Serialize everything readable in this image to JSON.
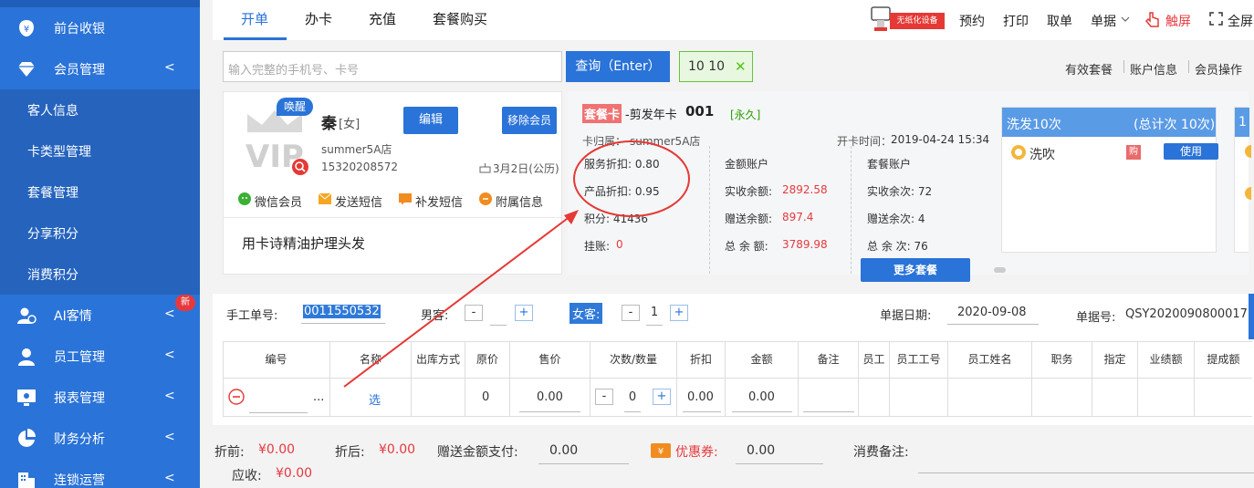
{
  "sidebar": {
    "items": [
      {
        "label": "前台收银",
        "icon": "yen-icon"
      },
      {
        "label": "会员管理",
        "icon": "diamond-icon"
      },
      {
        "label": "AI客情",
        "icon": "ai-user-icon",
        "badge": "新"
      },
      {
        "label": "员工管理",
        "icon": "person-icon"
      },
      {
        "label": "报表管理",
        "icon": "monitor-icon"
      },
      {
        "label": "财务分析",
        "icon": "pie-icon"
      },
      {
        "label": "连锁运营",
        "icon": "building-icon"
      }
    ],
    "sub_items": [
      "客人信息",
      "卡类型管理",
      "套餐管理",
      "分享积分",
      "消费积分"
    ],
    "chevron": "<"
  },
  "tabs": [
    "开单",
    "办卡",
    "充值",
    "套餐购买"
  ],
  "top_actions": {
    "device": "无纸化设备",
    "items": [
      "预约",
      "打印",
      "取单",
      "单据",
      "触屏",
      "全屏"
    ]
  },
  "search": {
    "placeholder": "输入完整的手机号、卡号",
    "button": "查询（Enter）",
    "tag": "10 10",
    "tag_close": "✕"
  },
  "links": [
    "有效套餐",
    "账户信息",
    "会员操作"
  ],
  "member": {
    "wake": "唤醒",
    "name": "秦",
    "gender": "[女]",
    "store": "summer5A店",
    "phone": "15320208572",
    "birthday": "3月2日(公历)",
    "edit": "编辑",
    "remove": "移除会员",
    "actions": [
      "微信会员",
      "发送短信",
      "补发短信",
      "附属信息"
    ],
    "note": "用卡诗精油护理头发",
    "vip": "VIP"
  },
  "card": {
    "type_tag": "套餐卡",
    "name": "-剪发年卡",
    "number": "001",
    "validity": "[永久]",
    "store_label": "卡归属：",
    "store": "summer5A店",
    "open_time_label": "开卡时间：",
    "open_time": "2019-04-24 15:34",
    "service_discount": "服务折扣: 0.80",
    "product_discount": "产品折扣: 0.95",
    "points": "积分: 41436",
    "credit_label": "挂账:",
    "credit": "0",
    "balance_title": "金额账户",
    "real_balance_label": "实收余额:",
    "real_balance": "2892.58",
    "gift_balance_label": "赠送余额:",
    "gift_balance": "897.4",
    "total_balance_label": "总 余 额:",
    "total_balance": "3789.98",
    "pkg_title": "套餐账户",
    "real_times": "实收余次: 72",
    "gift_times": "赠送余次: 4",
    "total_times": "总 余 次: 76",
    "more": "更多套餐"
  },
  "package": {
    "title": "洗发10次",
    "total": "(总计次 10次)",
    "item": "洗吹",
    "buy": "购",
    "use": "使用",
    "next_peek": "1"
  },
  "form": {
    "manual_label": "手工单号:",
    "manual_value": "0011550532",
    "male_label": "男客:",
    "male_value": "",
    "female_label": "女客:",
    "female_value": "1",
    "date_label": "单据日期:",
    "date": "2020-09-08",
    "docno_label": "单据号:",
    "docno": "QSY2020090800017",
    "minus": "-",
    "plus": "+"
  },
  "table": {
    "headers": [
      "编号",
      "名称",
      "出库方式",
      "原价",
      "售价",
      "次数/数量",
      "折扣",
      "金额",
      "备注",
      "员工",
      "员工工号",
      "员工姓名",
      "职务",
      "指定",
      "业绩额",
      "提成额"
    ],
    "row": {
      "dots": "...",
      "select": "选",
      "orig": "0",
      "price": "0.00",
      "qty": "0",
      "discount": "0.00",
      "amount": "0.00"
    }
  },
  "footer": {
    "before_label": "折前:",
    "before": "¥0.00",
    "after_label": "折后:",
    "after": "¥0.00",
    "gift_pay_label": "赠送金额支付:",
    "gift_pay": "0.00",
    "coupon_label": "优惠券:",
    "coupon": "0.00",
    "consume_note": "消费备注:",
    "receivable_label": "应收:",
    "receivable": "¥0.00"
  },
  "colors": {
    "primary": "#2a73d8",
    "red": "#e6393e",
    "annotation": "#e53935"
  }
}
